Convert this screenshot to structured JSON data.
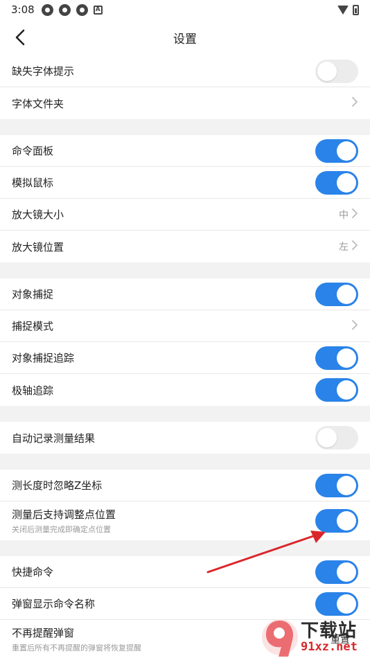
{
  "status_bar": {
    "time": "3:08",
    "notification_icons": [
      "gear-icon",
      "gear-icon",
      "gear-icon",
      "a-icon"
    ]
  },
  "header": {
    "title": "设置",
    "back_icon": "chevron-left-icon"
  },
  "groups": [
    {
      "rows": [
        {
          "label": "缺失字体提示",
          "control": "toggle",
          "on": false
        },
        {
          "label": "字体文件夹",
          "control": "chevron"
        }
      ]
    },
    {
      "rows": [
        {
          "label": "命令面板",
          "control": "toggle",
          "on": true
        },
        {
          "label": "模拟鼠标",
          "control": "toggle",
          "on": true
        },
        {
          "label": "放大镜大小",
          "control": "chevron",
          "value": "中"
        },
        {
          "label": "放大镜位置",
          "control": "chevron",
          "value": "左"
        }
      ]
    },
    {
      "rows": [
        {
          "label": "对象捕捉",
          "control": "toggle",
          "on": true
        },
        {
          "label": "捕捉模式",
          "control": "chevron"
        },
        {
          "label": "对象捕捉追踪",
          "control": "toggle",
          "on": true
        },
        {
          "label": "极轴追踪",
          "control": "toggle",
          "on": true
        }
      ]
    },
    {
      "rows": [
        {
          "label": "自动记录测量结果",
          "control": "toggle",
          "on": false
        }
      ]
    },
    {
      "rows": [
        {
          "label": "测长度时忽略Z坐标",
          "control": "toggle",
          "on": true
        },
        {
          "label": "测量后支持调整点位置",
          "sublabel": "关闭后测量完成即确定点位置",
          "control": "toggle",
          "on": true
        }
      ]
    },
    {
      "rows": [
        {
          "label": "快捷命令",
          "control": "toggle",
          "on": true
        },
        {
          "label": "弹窗显示命令名称",
          "control": "toggle",
          "on": true
        },
        {
          "label": "不再提醒弹窗",
          "sublabel": "重置后所有不再提醒的弹窗将恢复提醒",
          "control": "button",
          "button_label": "重置"
        }
      ]
    }
  ],
  "colors": {
    "toggle_on": "#2a83e8",
    "toggle_off": "#ececec",
    "annotation_arrow": "#d9262b"
  },
  "watermark": {
    "title": "下载站",
    "url": "91xz.net"
  }
}
